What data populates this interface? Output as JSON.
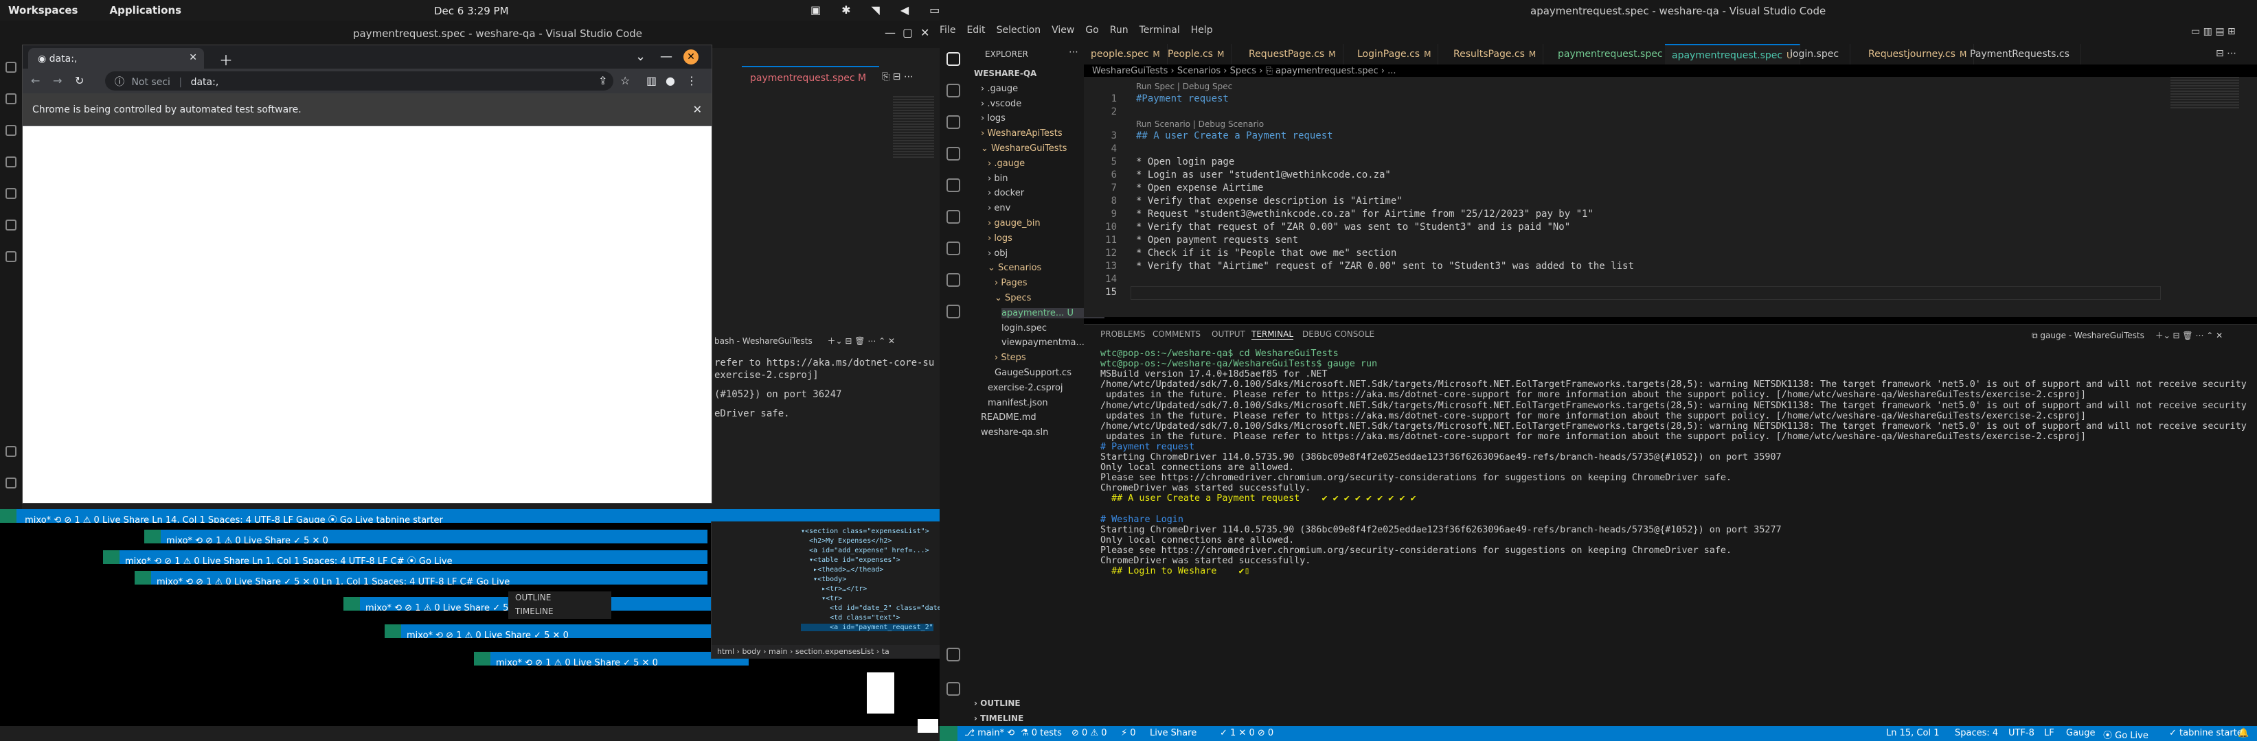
{
  "os": {
    "workspaces": "Workspaces",
    "applications": "Applications",
    "clock": "Dec 6  3:29 PM"
  },
  "left_window": {
    "title": "paymentrequest.spec - weshare-qa - Visual Studio Code",
    "tab": "paymentrequest.spec M",
    "terminal_header": "bash - WeshareGuiTests",
    "terminal_lines": [
      "refer to https://aka.ms/dotnet-core-su",
      "exercise-2.csproj]",
      "(#1052}) on port 36247",
      "",
      "",
      "eDriver safe."
    ],
    "status_stack": [
      {
        "text": "mixo*  ⟲  ⊘ 1 ⚠ 0   Live Share                                   Ln 14, Col 1   Spaces: 4   UTF-8   LF   Gauge   ⦿ Go Live   tabnine starter"
      },
      {
        "text": "mixo*  ⟲  ⊘ 1 ⚠ 0   Live Share  ✓ 5  ✕ 0"
      },
      {
        "text": "mixo*  ⟲  ⊘ 1 ⚠ 0   Live Share                  Ln 1, Col 1   Spaces: 4   UTF-8   LF   C#   ⦿ Go Live"
      },
      {
        "text": "mixo*  ⟲  ⊘ 1 ⚠ 0   Live Share  ✓ 5  ✕ 0   Ln 1, Col 1   Spaces: 4   UTF-8   LF   C#   Go Live"
      }
    ],
    "outline": "OUTLINE",
    "timeline": "TIMELINE"
  },
  "chrome": {
    "tab_title": "data:,",
    "url_security": "Not seci",
    "url": "data:,",
    "infobar": "Chrome is being controlled by automated test software."
  },
  "right_window": {
    "title": "apaymentrequest.spec - weshare-qa - Visual Studio Code",
    "menu": [
      "File",
      "Edit",
      "Selection",
      "View",
      "Go",
      "Run",
      "Terminal",
      "Help"
    ],
    "explorer_header": "EXPLORER",
    "tree": [
      {
        "label": "WESHARE-QA",
        "indent": 0,
        "color": "#cccccc"
      },
      {
        "label": "› .gauge",
        "indent": 1,
        "color": "#cccccc"
      },
      {
        "label": "› .vscode",
        "indent": 1,
        "color": "#cccccc"
      },
      {
        "label": "› logs",
        "indent": 1,
        "color": "#cccccc"
      },
      {
        "label": "› WeshareApiTests",
        "indent": 1,
        "color": "#e2c08d"
      },
      {
        "label": "⌄ WeshareGuiTests",
        "indent": 1,
        "color": "#e2c08d"
      },
      {
        "label": "› .gauge",
        "indent": 2,
        "color": "#e2c08d"
      },
      {
        "label": "› bin",
        "indent": 2,
        "color": "#cccccc"
      },
      {
        "label": "› docker",
        "indent": 2,
        "color": "#cccccc"
      },
      {
        "label": "› env",
        "indent": 2,
        "color": "#cccccc"
      },
      {
        "label": "› gauge_bin",
        "indent": 2,
        "color": "#e2c08d"
      },
      {
        "label": "› logs",
        "indent": 2,
        "color": "#e2c08d"
      },
      {
        "label": "› obj",
        "indent": 2,
        "color": "#cccccc"
      },
      {
        "label": "⌄ Scenarios",
        "indent": 2,
        "color": "#e2c08d"
      },
      {
        "label": "› Pages",
        "indent": 3,
        "color": "#e2c08d"
      },
      {
        "label": "⌄ Specs",
        "indent": 3,
        "color": "#e2c08d"
      },
      {
        "label": "apaymentre...  U",
        "indent": 4,
        "color": "#73c991"
      },
      {
        "label": "login.spec",
        "indent": 4,
        "color": "#cccccc"
      },
      {
        "label": "viewpaymentma...",
        "indent": 4,
        "color": "#cccccc"
      },
      {
        "label": "› Steps",
        "indent": 3,
        "color": "#e2c08d"
      },
      {
        "label": "GaugeSupport.cs",
        "indent": 3,
        "color": "#cccccc"
      },
      {
        "label": "exercise-2.csproj",
        "indent": 2,
        "color": "#cccccc"
      },
      {
        "label": "manifest.json",
        "indent": 2,
        "color": "#cccccc"
      },
      {
        "label": "README.md",
        "indent": 1,
        "color": "#cccccc"
      },
      {
        "label": "weshare-qa.sln",
        "indent": 1,
        "color": "#cccccc"
      }
    ],
    "tabs": [
      {
        "label": "people.spec",
        "mod": "M",
        "active": false
      },
      {
        "label": "People.cs",
        "mod": "M",
        "active": false
      },
      {
        "label": "RequestPage.cs",
        "mod": "M",
        "active": false
      },
      {
        "label": "LoginPage.cs",
        "mod": "M",
        "active": false
      },
      {
        "label": "ResultsPage.cs",
        "mod": "M",
        "active": false
      },
      {
        "label": "paymentrequest.spec",
        "mod": "U",
        "active": false
      },
      {
        "label": "apaymentrequest.spec",
        "mod": "U",
        "active": true
      },
      {
        "label": "login.spec",
        "mod": "",
        "active": false
      },
      {
        "label": "Requestjourney.cs",
        "mod": "M",
        "active": false
      },
      {
        "label": "PaymentRequests.cs",
        "mod": "",
        "active": false
      }
    ],
    "breadcrumb": "WeshareGuiTests › Scenarios › Specs › ⎘ apaymentrequest.spec › ...",
    "lens1": "Run Spec | Debug Spec",
    "lens2": "Run Scenario | Debug Scenario",
    "code": [
      {
        "n": "1",
        "text": "#Payment request",
        "color": "#569cd6"
      },
      {
        "n": "2",
        "text": "",
        "color": "#cccccc"
      },
      {
        "n": "3",
        "text": "## A user Create a Payment request",
        "color": "#569cd6"
      },
      {
        "n": "4",
        "text": "",
        "color": "#cccccc"
      },
      {
        "n": "5",
        "text": "* Open login page",
        "color": "#cccccc"
      },
      {
        "n": "6",
        "text": "* Login as user \"student1@wethinkcode.co.za\"",
        "color": "#cccccc"
      },
      {
        "n": "7",
        "text": "* Open expense Airtime",
        "color": "#cccccc"
      },
      {
        "n": "8",
        "text": "* Verify that expense description is \"Airtime\"",
        "color": "#cccccc"
      },
      {
        "n": "9",
        "text": "* Request \"student3@wethinkcode.co.za\" for Airtime from \"25/12/2023\" pay by \"1\"",
        "color": "#cccccc"
      },
      {
        "n": "10",
        "text": "* Verify that request of \"ZAR 0.00\" was sent to \"Student3\" and is paid \"No\"",
        "color": "#cccccc"
      },
      {
        "n": "11",
        "text": "* Open payment requests sent",
        "color": "#cccccc"
      },
      {
        "n": "12",
        "text": "* Check if it is \"People that owe me\" section",
        "color": "#cccccc"
      },
      {
        "n": "13",
        "text": "* Verify that \"Airtime\" request of \"ZAR 0.00\" sent to \"Student3\" was added to the list",
        "color": "#cccccc"
      },
      {
        "n": "14",
        "text": "",
        "color": "#cccccc"
      },
      {
        "n": "15",
        "text": "",
        "color": "#cccccc"
      }
    ],
    "panel_tabs": [
      "PROBLEMS",
      "COMMENTS",
      "OUTPUT",
      "TERMINAL",
      "DEBUG CONSOLE"
    ],
    "terminal_title": "gauge - WeshareGuiTests",
    "terminal": [
      {
        "text": "wtc@pop-os:~/weshare-qa$ cd WeshareGuiTests",
        "color": "#73c991"
      },
      {
        "text": "wtc@pop-os:~/weshare-qa/WeshareGuiTests$ gauge run",
        "color": "#73c991"
      },
      {
        "text": "MSBuild version 17.4.0+18d5aef85 for .NET",
        "color": "#cccccc"
      },
      {
        "text": "/home/wtc/Updated/sdk/7.0.100/Sdks/Microsoft.NET.Sdk/targets/Microsoft.NET.EolTargetFrameworks.targets(28,5): warning NETSDK1138: The target framework 'net5.0' is out of support and will not receive security",
        "color": "#cccccc"
      },
      {
        "text": " updates in the future. Please refer to https://aka.ms/dotnet-core-support for more information about the support policy. [/home/wtc/weshare-qa/WeshareGuiTests/exercise-2.csproj]",
        "color": "#cccccc"
      },
      {
        "text": "/home/wtc/Updated/sdk/7.0.100/Sdks/Microsoft.NET.Sdk/targets/Microsoft.NET.EolTargetFrameworks.targets(28,5): warning NETSDK1138: The target framework 'net5.0' is out of support and will not receive security",
        "color": "#cccccc"
      },
      {
        "text": " updates in the future. Please refer to https://aka.ms/dotnet-core-support for more information about the support policy. [/home/wtc/weshare-qa/WeshareGuiTests/exercise-2.csproj]",
        "color": "#cccccc"
      },
      {
        "text": "/home/wtc/Updated/sdk/7.0.100/Sdks/Microsoft.NET.Sdk/targets/Microsoft.NET.EolTargetFrameworks.targets(28,5): warning NETSDK1138: The target framework 'net5.0' is out of support and will not receive security",
        "color": "#cccccc"
      },
      {
        "text": " updates in the future. Please refer to https://aka.ms/dotnet-core-support for more information about the support policy. [/home/wtc/weshare-qa/WeshareGuiTests/exercise-2.csproj]",
        "color": "#cccccc"
      },
      {
        "text": "# Payment request",
        "color": "#3b8eea"
      },
      {
        "text": "Starting ChromeDriver 114.0.5735.90 (386bc09e8f4f2e025eddae123f36f6263096ae49-refs/branch-heads/5735@{#1052}) on port 35907",
        "color": "#cccccc"
      },
      {
        "text": "Only local connections are allowed.",
        "color": "#cccccc"
      },
      {
        "text": "Please see https://chromedriver.chromium.org/security-considerations for suggestions on keeping ChromeDriver safe.",
        "color": "#cccccc"
      },
      {
        "text": "ChromeDriver was started successfully.",
        "color": "#cccccc"
      },
      {
        "text": "  ## A user Create a Payment request    ✔ ✔ ✔ ✔ ✔ ✔ ✔ ✔ ✔",
        "color": "#e5e510"
      },
      {
        "text": "",
        "color": "#cccccc"
      },
      {
        "text": "# Weshare Login",
        "color": "#3b8eea"
      },
      {
        "text": "Starting ChromeDriver 114.0.5735.90 (386bc09e8f4f2e025eddae123f36f6263096ae49-refs/branch-heads/5735@{#1052}) on port 35277",
        "color": "#cccccc"
      },
      {
        "text": "Only local connections are allowed.",
        "color": "#cccccc"
      },
      {
        "text": "Please see https://chromedriver.chromium.org/security-considerations for suggestions on keeping ChromeDriver safe.",
        "color": "#cccccc"
      },
      {
        "text": "ChromeDriver was started successfully.",
        "color": "#cccccc"
      },
      {
        "text": "  ## Login to Weshare    ✔▯",
        "color": "#e5e510"
      }
    ],
    "outline": "OUTLINE",
    "timeline": "TIMELINE",
    "status": {
      "branch": "⎇ main*  ⟲",
      "tests": "⚗ 0 tests",
      "problems": "⊘ 0 ⚠ 0",
      "ports": "⚡ 0",
      "liveshare": "Live Share",
      "checks": "✓ 1  ✕ 0  ⊘ 0",
      "pos": "Ln 15, Col 1",
      "spaces": "Spaces: 4",
      "enc": "UTF-8",
      "eol": "LF",
      "lang": "Gauge",
      "golive": "⦿ Go Live",
      "tabnine": "✓ tabnine starter"
    }
  }
}
